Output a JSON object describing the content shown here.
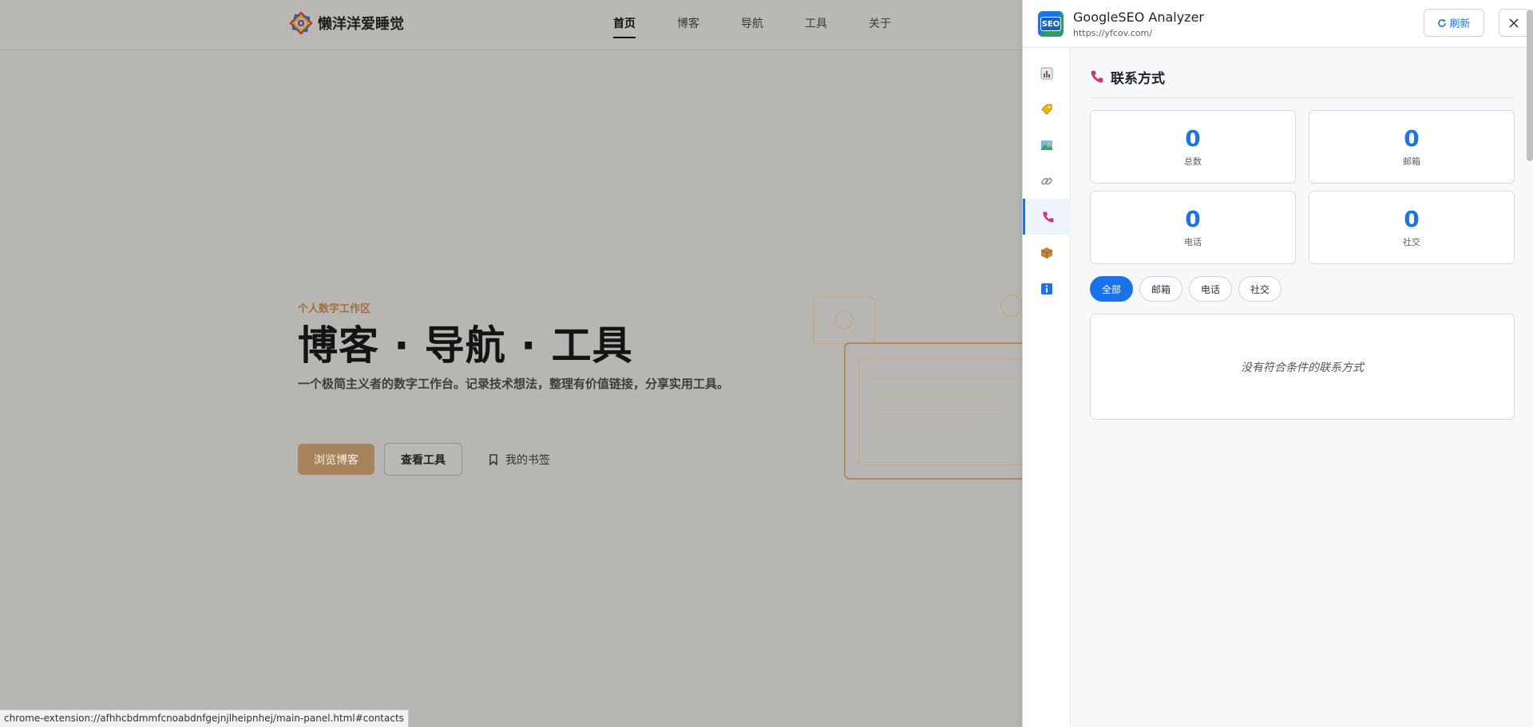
{
  "site": {
    "logo_text": "懒洋洋爱睡觉",
    "nav": [
      "首页",
      "博客",
      "导航",
      "工具",
      "关于"
    ],
    "eyebrow": "个人数字工作区",
    "title": "博客 · 导航 · 工具",
    "description": "一个极简主义者的数字工作台。记录技术想法，整理有价值链接，分享实用工具。",
    "primary_button": "浏览博客",
    "secondary_button": "查看工具",
    "bookmark_link": "我的书签"
  },
  "status_bar": {
    "url": "chrome-extension://afhhcbdmmfcnoabdnfgejnjlheipnhej/main-panel.html#contacts"
  },
  "panel": {
    "app_icon_text": "SEO",
    "app_name": "GoogleSEO Analyzer",
    "app_url": "https://yfcov.com/",
    "refresh_label": "刷新",
    "rail_icons": [
      "chart-icon",
      "tag-icon",
      "image-icon",
      "link-icon",
      "phone-icon",
      "package-icon",
      "info-icon"
    ],
    "active_rail": "phone-icon",
    "section_title": "联系方式",
    "stats": [
      {
        "value": "0",
        "label": "总数"
      },
      {
        "value": "0",
        "label": "邮箱"
      },
      {
        "value": "0",
        "label": "电话"
      },
      {
        "value": "0",
        "label": "社交"
      }
    ],
    "filters": [
      "全部",
      "邮箱",
      "电话",
      "社交"
    ],
    "active_filter": "全部",
    "empty_message": "没有符合条件的联系方式"
  },
  "colors": {
    "accent": "#1a73e8",
    "brand_tan": "#a8845c",
    "phone_icon": "#d6336c"
  }
}
